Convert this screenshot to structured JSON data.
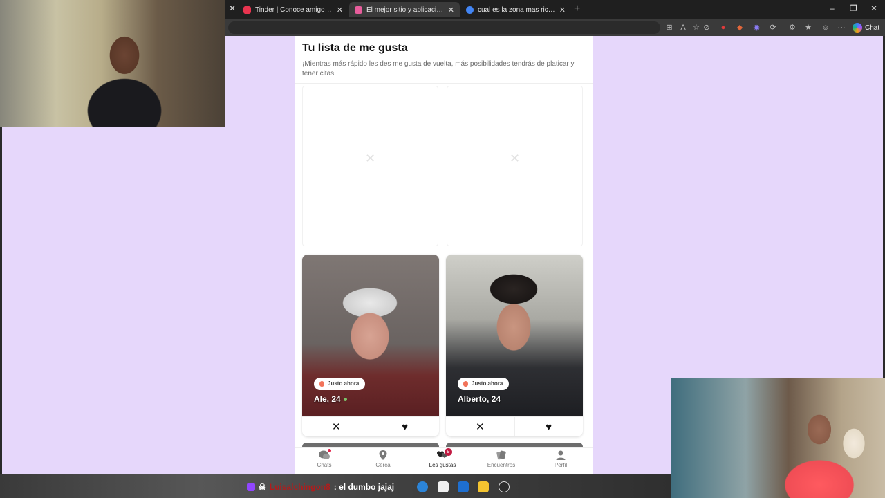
{
  "browser": {
    "tabs": [
      {
        "title": "Tinder | Conoce amigos y gente nueva",
        "favicon_color": "#e8344f",
        "active": false
      },
      {
        "title": "El mejor sitio y aplicación de citas",
        "favicon_color": "#e85d9c",
        "active": true
      },
      {
        "title": "cual es la zona mas rica para vivir en",
        "favicon_color": "#4285f4",
        "active": false
      }
    ],
    "new_tab": "+",
    "close_glyph": "✕",
    "copilot_label": "Chat"
  },
  "page": {
    "bg_color": "#e6d7fb",
    "title": "Tu lista de me gusta",
    "subtitle": "¡Mientras más rápido les des me gusta de vuelta, más posibilidades tendrás de platicar y tener citas!",
    "cards": [
      {
        "name_age": "Ale, 24",
        "badge": "Justo ahora",
        "online": true
      },
      {
        "name_age": "Alberto, 24",
        "badge": "Justo ahora",
        "online": false
      }
    ],
    "dislike_glyph": "✕",
    "like_glyph": "♥"
  },
  "bottom_nav": [
    {
      "label": "Chats",
      "icon": "chat-bubbles-icon",
      "has_dot": true
    },
    {
      "label": "Cerca",
      "icon": "location-pin-icon"
    },
    {
      "label": "Les gustas",
      "icon": "hearts-icon",
      "count": "9",
      "active": true
    },
    {
      "label": "Encuentros",
      "icon": "cards-icon"
    },
    {
      "label": "Perfil",
      "icon": "person-icon"
    }
  ],
  "stream_chat": {
    "username": "Luisalchingon8",
    "message": ": el dumbo jajaj"
  }
}
